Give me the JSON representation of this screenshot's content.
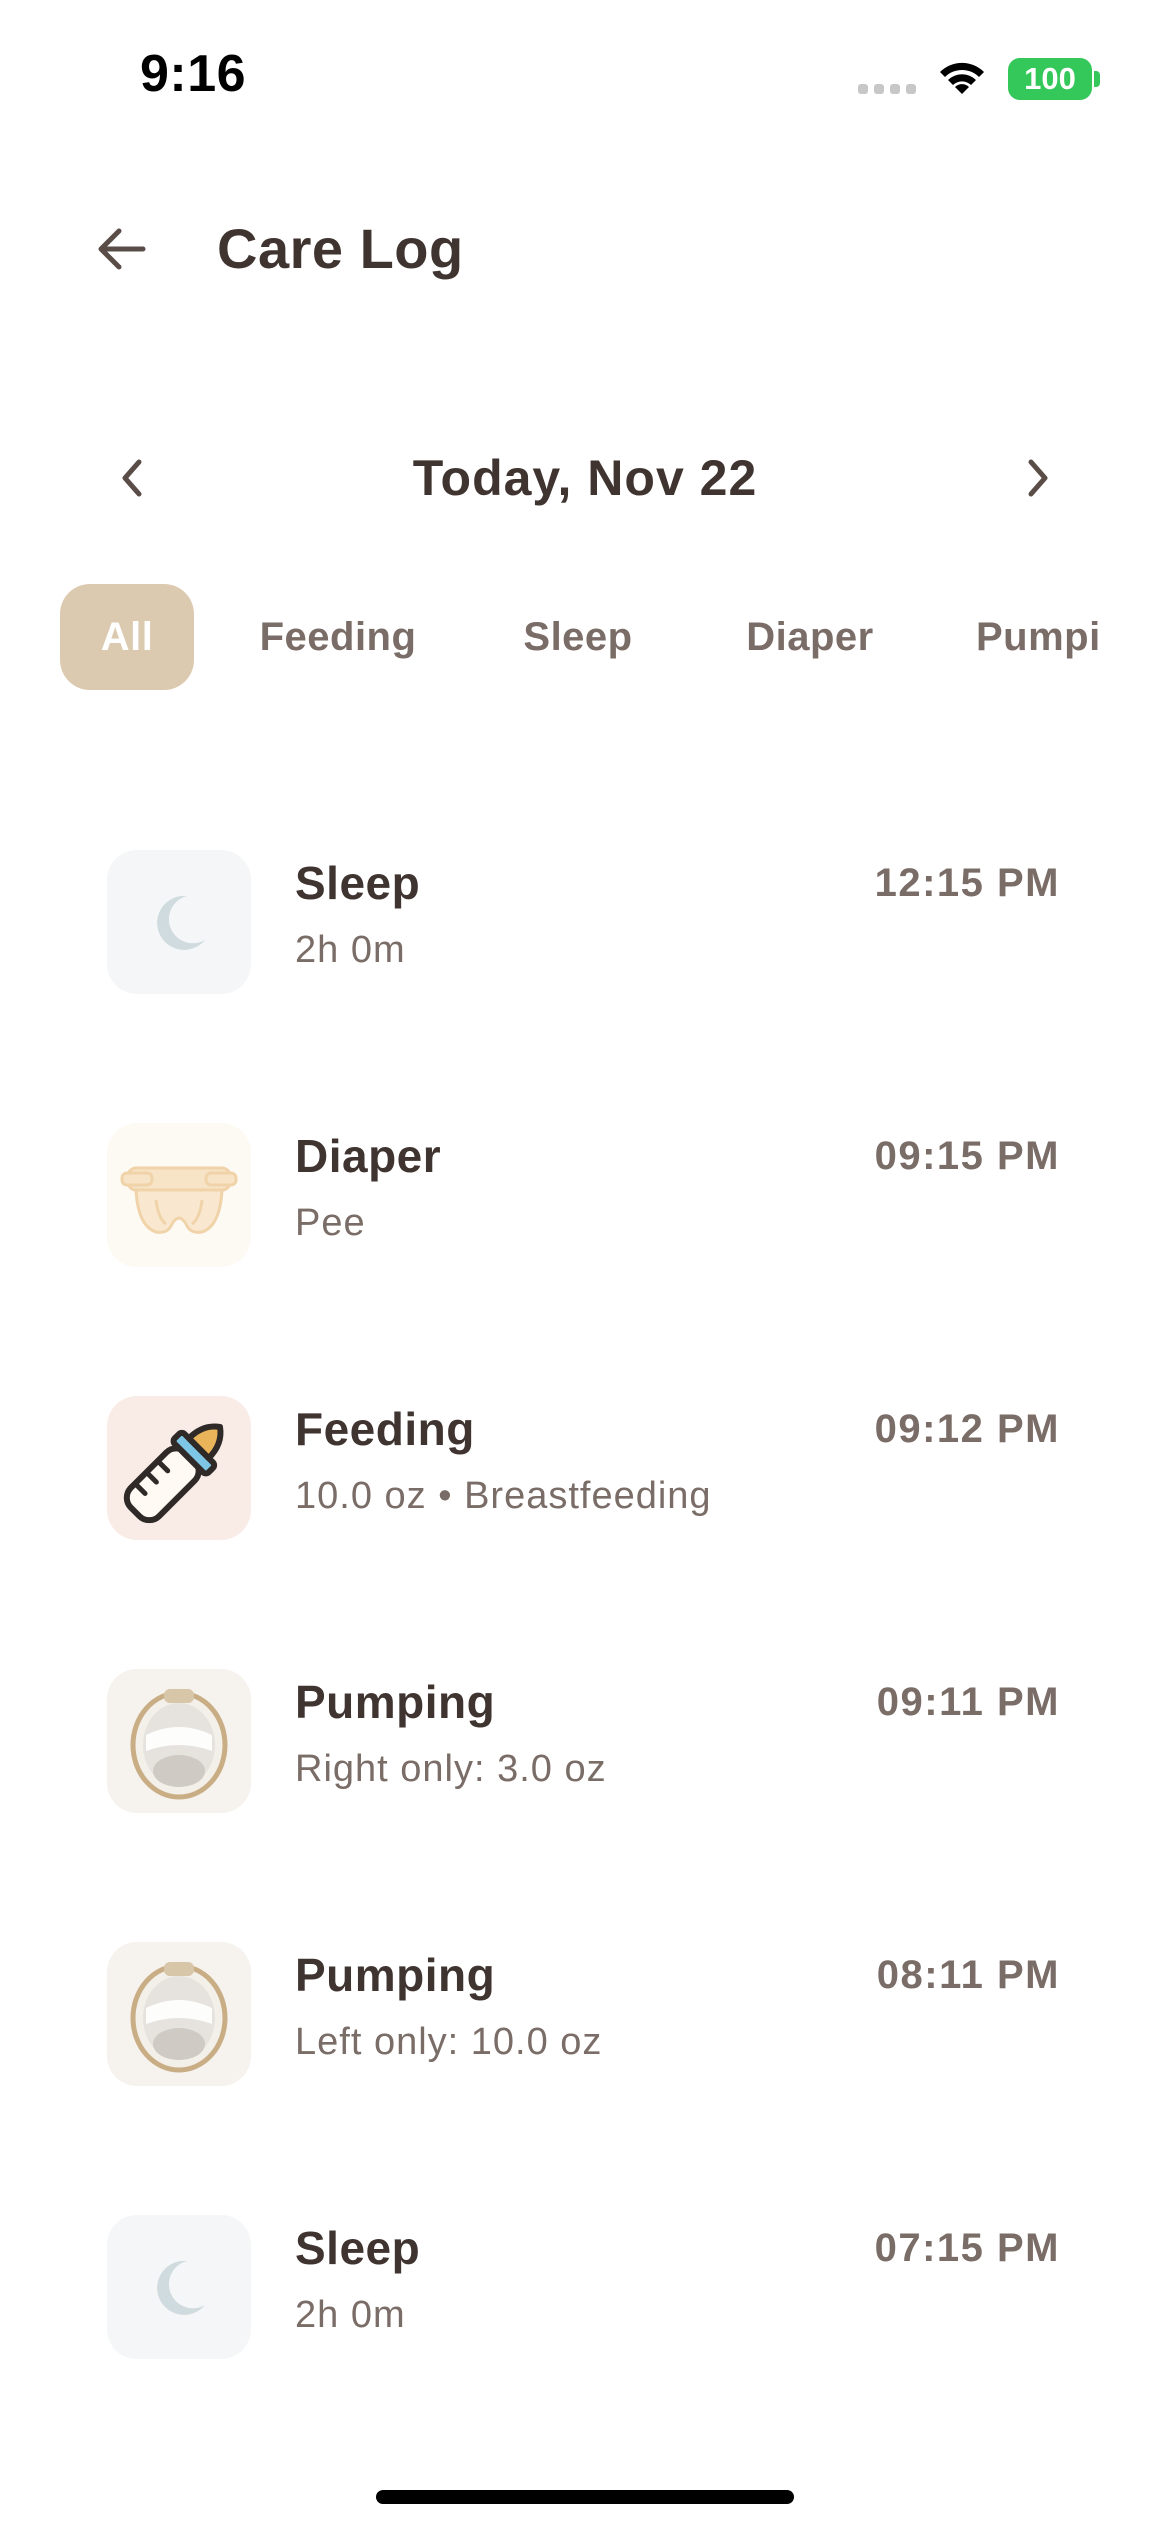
{
  "status_bar": {
    "time": "9:16",
    "battery": "100",
    "colors": {
      "battery": "#34c759"
    }
  },
  "header": {
    "title": "Care Log",
    "back_icon": "arrow-left-icon"
  },
  "date_nav": {
    "label": "Today, Nov 22",
    "prev_icon": "chevron-left-icon",
    "next_icon": "chevron-right-icon"
  },
  "filters": {
    "selected": "All",
    "items": [
      "All",
      "Feeding",
      "Sleep",
      "Diaper",
      "Pumpi"
    ]
  },
  "logs": [
    {
      "type": "Sleep",
      "detail": "2h 0m",
      "time": "12:15 PM",
      "icon": "moon-icon"
    },
    {
      "type": "Diaper",
      "detail": "Pee",
      "time": "09:15 PM",
      "icon": "diaper-icon"
    },
    {
      "type": "Feeding",
      "detail": "10.0 oz • Breastfeeding",
      "time": "09:12 PM",
      "icon": "bottle-icon"
    },
    {
      "type": "Pumping",
      "detail": "Right only: 3.0 oz",
      "time": "09:11 PM",
      "icon": "breast-pump-icon"
    },
    {
      "type": "Pumping",
      "detail": "Left only: 10.0 oz",
      "time": "08:11 PM",
      "icon": "breast-pump-icon"
    },
    {
      "type": "Sleep",
      "detail": "2h 0m",
      "time": "07:15 PM",
      "icon": "moon-icon"
    }
  ],
  "colors": {
    "text_primary": "#3f3430",
    "text_secondary": "#7a6c66",
    "filter_active_bg": "#dccab0",
    "sleep_icon_bg": "#f4f6f7",
    "diaper_icon_bg": "#fdfaf4",
    "feeding_icon_bg": "#f9ece7",
    "pumping_icon_bg": "#f6f2ee"
  }
}
